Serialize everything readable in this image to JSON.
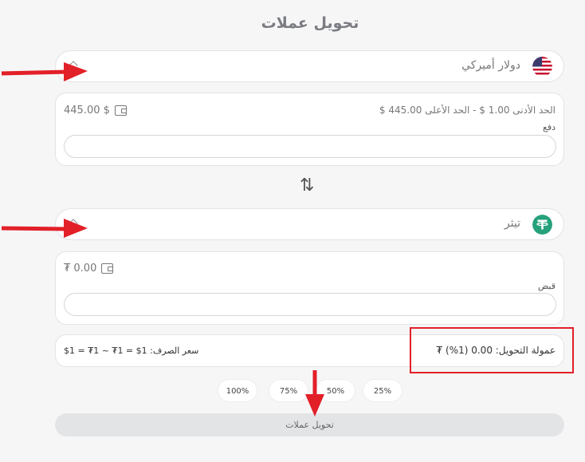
{
  "page": {
    "title": "تحويل عملات"
  },
  "from": {
    "currency": "دولار أميركي",
    "balance": "445.00 $",
    "limits": "الحد الأدنى 1.00 $   -   الحد الأعلى 445.00 $",
    "field_label": "دفع"
  },
  "to": {
    "currency": "تيثر",
    "balance": "₮ 0.00",
    "field_label": "قبض"
  },
  "info": {
    "fee": "عمولة التحويل: 0.00 (1%) ₮",
    "rate": "سعر الصرف: 1$ = 1₮ ~ 1₮ = 1$"
  },
  "percent_buttons": [
    "100%",
    "75%",
    "50%",
    "25%"
  ],
  "convert_label": "تحويل عملات",
  "colors": {
    "highlight": "#e22028",
    "tether": "#26a17b"
  }
}
